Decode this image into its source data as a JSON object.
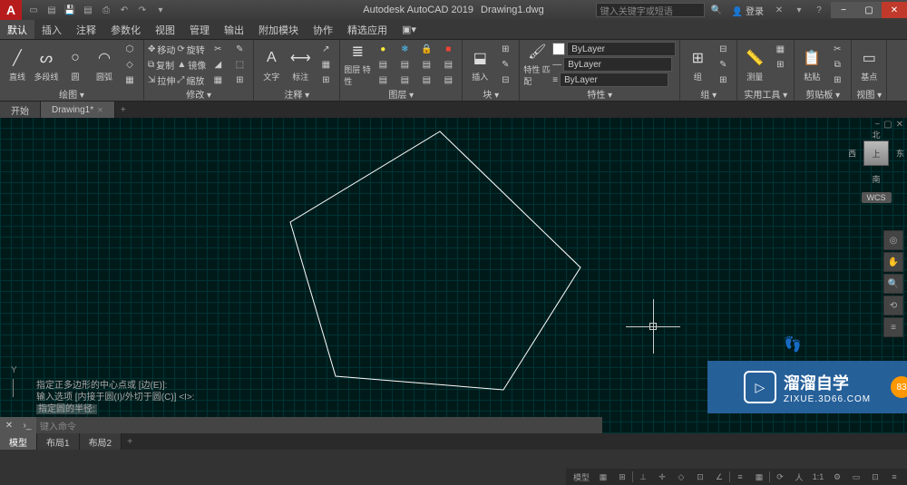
{
  "title": {
    "app": "Autodesk AutoCAD 2019",
    "file": "Drawing1.dwg"
  },
  "search": {
    "placeholder": "键入关键字或短语"
  },
  "user": {
    "label": "登录"
  },
  "tabs": {
    "items": [
      "默认",
      "插入",
      "注释",
      "参数化",
      "视图",
      "管理",
      "输出",
      "附加模块",
      "协作",
      "精选应用"
    ],
    "active": 0
  },
  "ribbon": {
    "draw": {
      "title": "绘图 ▾",
      "line": "直线",
      "polyline": "多段线",
      "circle": "圆",
      "arc": "圆弧"
    },
    "modify": {
      "title": "修改 ▾",
      "move": "移动",
      "rotate": "旋转",
      "copy": "复制",
      "mirror": "镜像",
      "stretch": "拉伸",
      "scale": "缩放"
    },
    "annotate": {
      "title": "注释 ▾",
      "text": "文字",
      "dim": "标注"
    },
    "layers": {
      "title": "图层 ▾",
      "props": "图层\n特性"
    },
    "blocks": {
      "title": "块 ▾",
      "insert": "插入"
    },
    "props": {
      "title": "特性 ▾",
      "match": "特性\n匹配",
      "layer_sel": "ByLayer",
      "lt_sel": "ByLayer",
      "lw_sel": "ByLayer"
    },
    "groups": {
      "title": "组 ▾",
      "group": "组"
    },
    "utils": {
      "title": "实用工具 ▾",
      "measure": "测量"
    },
    "clipboard": {
      "title": "剪贴板 ▾",
      "paste": "粘贴"
    },
    "view": {
      "title": "视图 ▾",
      "base": "基点"
    }
  },
  "doc_tabs": {
    "start": "开始",
    "drawing": "Drawing1*"
  },
  "viewcube": {
    "n": "北",
    "s": "南",
    "e": "东",
    "w": "西",
    "top": "上",
    "wcs": "WCS"
  },
  "cmd": {
    "l1": "指定正多边形的中心点或 [边(E)]:",
    "l2": "输入选项 [内接于圆(I)/外切于圆(C)] <I>:",
    "l3": "指定圆的半径:",
    "prompt": "键入命令"
  },
  "layout_tabs": {
    "model": "模型",
    "l1": "布局1",
    "l2": "布局2"
  },
  "status": {
    "model": "模型"
  },
  "ucs": {
    "y": "Y"
  },
  "watermark": {
    "main": "溜溜自学",
    "sub": "ZIXUE.3D66.COM",
    "badge": "83"
  }
}
